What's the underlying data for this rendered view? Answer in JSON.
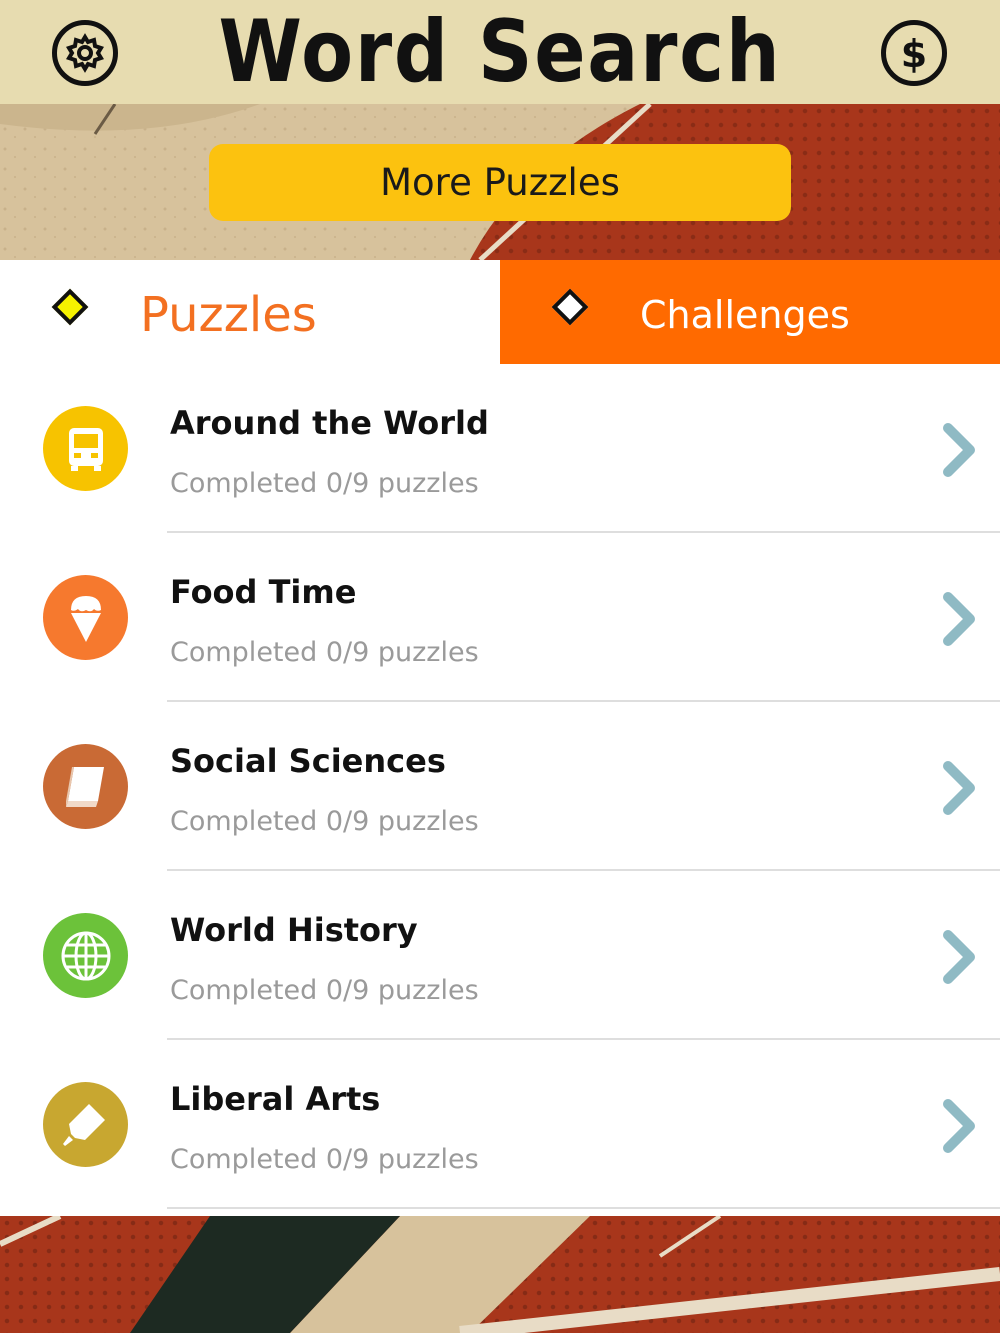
{
  "header": {
    "title": "Word Search",
    "left_icon": "gear-icon",
    "right_icon": "dollar-icon"
  },
  "banner": {
    "more_puzzles_label": "More Puzzles"
  },
  "tabs": [
    {
      "label": "Puzzles",
      "selected": true
    },
    {
      "label": "Challenges",
      "selected": false
    }
  ],
  "categories": [
    {
      "title": "Around the World",
      "subtitle": "Completed 0/9 puzzles",
      "icon": "bus-icon",
      "color": "#f7c300"
    },
    {
      "title": "Food Time",
      "subtitle": "Completed 0/9 puzzles",
      "icon": "ice-cream-icon",
      "color": "#f6792e"
    },
    {
      "title": "Social Sciences",
      "subtitle": "Completed 0/9 puzzles",
      "icon": "book-icon",
      "color": "#c96a35"
    },
    {
      "title": "World History",
      "subtitle": "Completed 0/9 puzzles",
      "icon": "globe-icon",
      "color": "#6cc23a"
    },
    {
      "title": "Liberal Arts",
      "subtitle": "Completed 0/9 puzzles",
      "icon": "marker-icon",
      "color": "#c8a730"
    }
  ],
  "colors": {
    "header_bg": "#e7dcb0",
    "accent_orange": "#ff6a00",
    "button_yellow": "#fcc20f",
    "chevron": "#8fbac4"
  }
}
